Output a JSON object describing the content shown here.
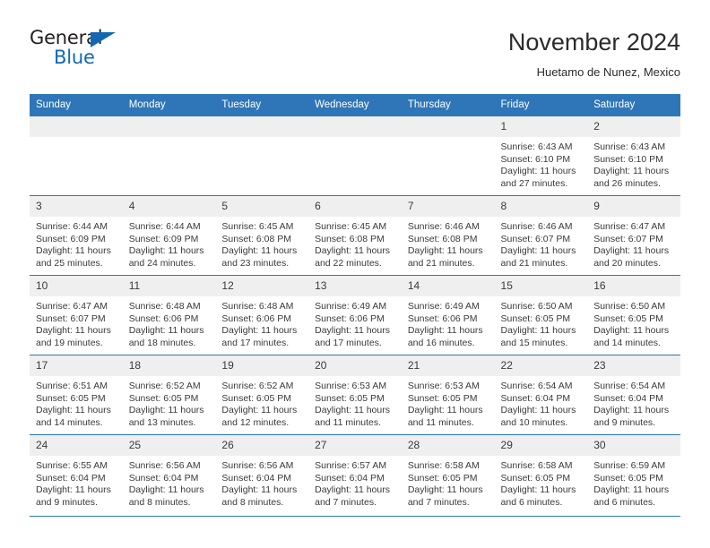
{
  "brand": {
    "name_part1": "General",
    "name_part2": "Blue",
    "accent_color": "#1268b3"
  },
  "header": {
    "title": "November 2024",
    "subtitle": "Huetamo de Nunez, Mexico"
  },
  "theme": {
    "header_blue": "#2e76b8",
    "daynum_band": "#efefef"
  },
  "weekday_headers": [
    "Sunday",
    "Monday",
    "Tuesday",
    "Wednesday",
    "Thursday",
    "Friday",
    "Saturday"
  ],
  "weeks": [
    [
      {
        "day": "",
        "empty": true
      },
      {
        "day": "",
        "empty": true
      },
      {
        "day": "",
        "empty": true
      },
      {
        "day": "",
        "empty": true
      },
      {
        "day": "",
        "empty": true
      },
      {
        "day": "1",
        "sunrise": "Sunrise: 6:43 AM",
        "sunset": "Sunset: 6:10 PM",
        "daylight": "Daylight: 11 hours and 27 minutes."
      },
      {
        "day": "2",
        "sunrise": "Sunrise: 6:43 AM",
        "sunset": "Sunset: 6:10 PM",
        "daylight": "Daylight: 11 hours and 26 minutes."
      }
    ],
    [
      {
        "day": "3",
        "sunrise": "Sunrise: 6:44 AM",
        "sunset": "Sunset: 6:09 PM",
        "daylight": "Daylight: 11 hours and 25 minutes."
      },
      {
        "day": "4",
        "sunrise": "Sunrise: 6:44 AM",
        "sunset": "Sunset: 6:09 PM",
        "daylight": "Daylight: 11 hours and 24 minutes."
      },
      {
        "day": "5",
        "sunrise": "Sunrise: 6:45 AM",
        "sunset": "Sunset: 6:08 PM",
        "daylight": "Daylight: 11 hours and 23 minutes."
      },
      {
        "day": "6",
        "sunrise": "Sunrise: 6:45 AM",
        "sunset": "Sunset: 6:08 PM",
        "daylight": "Daylight: 11 hours and 22 minutes."
      },
      {
        "day": "7",
        "sunrise": "Sunrise: 6:46 AM",
        "sunset": "Sunset: 6:08 PM",
        "daylight": "Daylight: 11 hours and 21 minutes."
      },
      {
        "day": "8",
        "sunrise": "Sunrise: 6:46 AM",
        "sunset": "Sunset: 6:07 PM",
        "daylight": "Daylight: 11 hours and 21 minutes."
      },
      {
        "day": "9",
        "sunrise": "Sunrise: 6:47 AM",
        "sunset": "Sunset: 6:07 PM",
        "daylight": "Daylight: 11 hours and 20 minutes."
      }
    ],
    [
      {
        "day": "10",
        "sunrise": "Sunrise: 6:47 AM",
        "sunset": "Sunset: 6:07 PM",
        "daylight": "Daylight: 11 hours and 19 minutes."
      },
      {
        "day": "11",
        "sunrise": "Sunrise: 6:48 AM",
        "sunset": "Sunset: 6:06 PM",
        "daylight": "Daylight: 11 hours and 18 minutes."
      },
      {
        "day": "12",
        "sunrise": "Sunrise: 6:48 AM",
        "sunset": "Sunset: 6:06 PM",
        "daylight": "Daylight: 11 hours and 17 minutes."
      },
      {
        "day": "13",
        "sunrise": "Sunrise: 6:49 AM",
        "sunset": "Sunset: 6:06 PM",
        "daylight": "Daylight: 11 hours and 17 minutes."
      },
      {
        "day": "14",
        "sunrise": "Sunrise: 6:49 AM",
        "sunset": "Sunset: 6:06 PM",
        "daylight": "Daylight: 11 hours and 16 minutes."
      },
      {
        "day": "15",
        "sunrise": "Sunrise: 6:50 AM",
        "sunset": "Sunset: 6:05 PM",
        "daylight": "Daylight: 11 hours and 15 minutes."
      },
      {
        "day": "16",
        "sunrise": "Sunrise: 6:50 AM",
        "sunset": "Sunset: 6:05 PM",
        "daylight": "Daylight: 11 hours and 14 minutes."
      }
    ],
    [
      {
        "day": "17",
        "sunrise": "Sunrise: 6:51 AM",
        "sunset": "Sunset: 6:05 PM",
        "daylight": "Daylight: 11 hours and 14 minutes."
      },
      {
        "day": "18",
        "sunrise": "Sunrise: 6:52 AM",
        "sunset": "Sunset: 6:05 PM",
        "daylight": "Daylight: 11 hours and 13 minutes."
      },
      {
        "day": "19",
        "sunrise": "Sunrise: 6:52 AM",
        "sunset": "Sunset: 6:05 PM",
        "daylight": "Daylight: 11 hours and 12 minutes."
      },
      {
        "day": "20",
        "sunrise": "Sunrise: 6:53 AM",
        "sunset": "Sunset: 6:05 PM",
        "daylight": "Daylight: 11 hours and 11 minutes."
      },
      {
        "day": "21",
        "sunrise": "Sunrise: 6:53 AM",
        "sunset": "Sunset: 6:05 PM",
        "daylight": "Daylight: 11 hours and 11 minutes."
      },
      {
        "day": "22",
        "sunrise": "Sunrise: 6:54 AM",
        "sunset": "Sunset: 6:04 PM",
        "daylight": "Daylight: 11 hours and 10 minutes."
      },
      {
        "day": "23",
        "sunrise": "Sunrise: 6:54 AM",
        "sunset": "Sunset: 6:04 PM",
        "daylight": "Daylight: 11 hours and 9 minutes."
      }
    ],
    [
      {
        "day": "24",
        "sunrise": "Sunrise: 6:55 AM",
        "sunset": "Sunset: 6:04 PM",
        "daylight": "Daylight: 11 hours and 9 minutes."
      },
      {
        "day": "25",
        "sunrise": "Sunrise: 6:56 AM",
        "sunset": "Sunset: 6:04 PM",
        "daylight": "Daylight: 11 hours and 8 minutes."
      },
      {
        "day": "26",
        "sunrise": "Sunrise: 6:56 AM",
        "sunset": "Sunset: 6:04 PM",
        "daylight": "Daylight: 11 hours and 8 minutes."
      },
      {
        "day": "27",
        "sunrise": "Sunrise: 6:57 AM",
        "sunset": "Sunset: 6:04 PM",
        "daylight": "Daylight: 11 hours and 7 minutes."
      },
      {
        "day": "28",
        "sunrise": "Sunrise: 6:58 AM",
        "sunset": "Sunset: 6:05 PM",
        "daylight": "Daylight: 11 hours and 7 minutes."
      },
      {
        "day": "29",
        "sunrise": "Sunrise: 6:58 AM",
        "sunset": "Sunset: 6:05 PM",
        "daylight": "Daylight: 11 hours and 6 minutes."
      },
      {
        "day": "30",
        "sunrise": "Sunrise: 6:59 AM",
        "sunset": "Sunset: 6:05 PM",
        "daylight": "Daylight: 11 hours and 6 minutes."
      }
    ]
  ]
}
